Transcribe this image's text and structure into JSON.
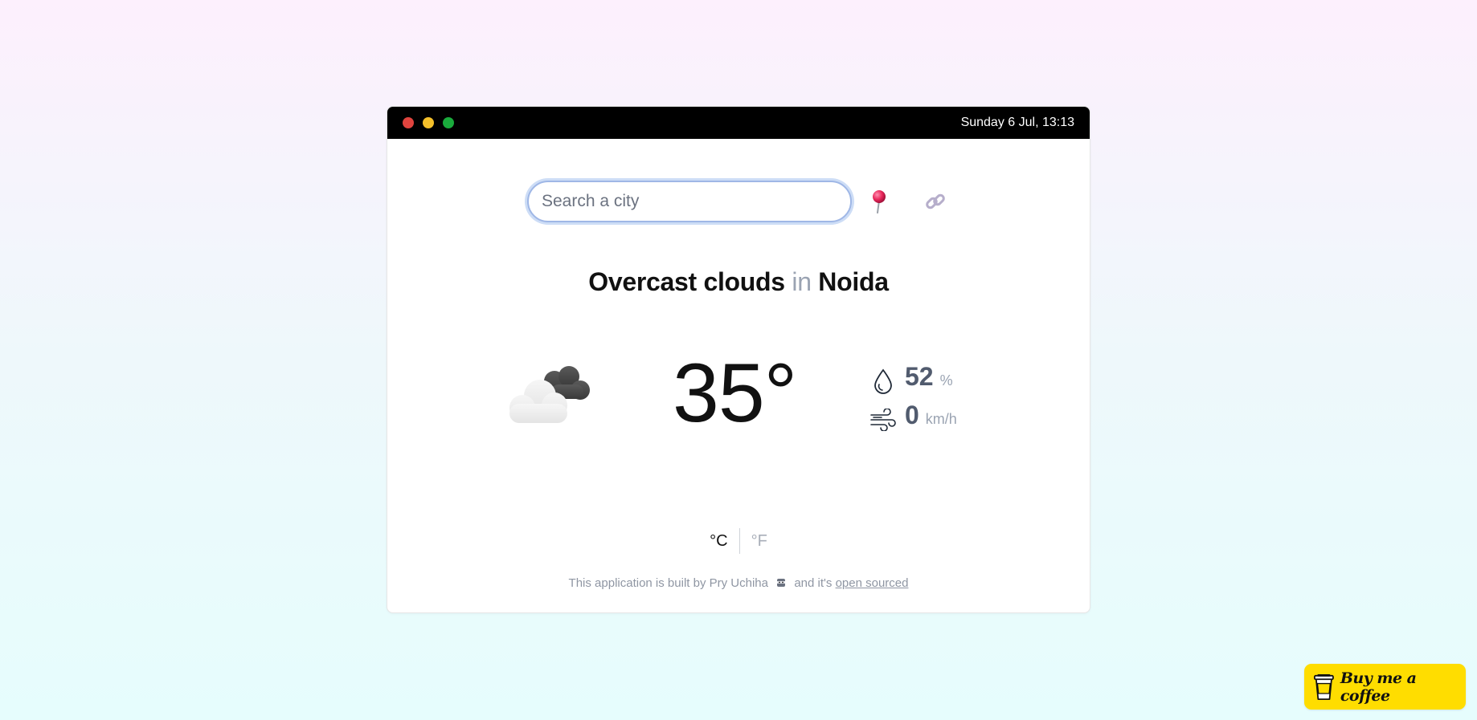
{
  "titlebar": {
    "datetime": "Sunday 6 Jul, 13:13",
    "dots": [
      {
        "name": "close",
        "color": "#e0443e"
      },
      {
        "name": "minimize",
        "color": "#f5c02a"
      },
      {
        "name": "maximize",
        "color": "#1aab3c"
      }
    ]
  },
  "search": {
    "placeholder": "Search a city",
    "value": "",
    "location_icon": "pin-icon",
    "share_icon": "link-icon"
  },
  "headline": {
    "condition": "Overcast clouds",
    "connector": "in",
    "city": "Noida"
  },
  "weather": {
    "icon": "overcast-cloud-icon",
    "temperature": "35°",
    "humidity": {
      "value": "52",
      "unit": "%",
      "icon": "droplet-icon"
    },
    "wind": {
      "value": "0",
      "unit": "km/h",
      "icon": "wind-icon"
    }
  },
  "units": {
    "celsius": "°C",
    "fahrenheit": "°F",
    "selected": "celsius"
  },
  "footer": {
    "text_before": "This application is built by Pry Uchiha",
    "text_middle": "and it's",
    "link_text": "open sourced"
  },
  "coffee": {
    "label": "Buy me a coffee",
    "color": "#ffdd00"
  }
}
